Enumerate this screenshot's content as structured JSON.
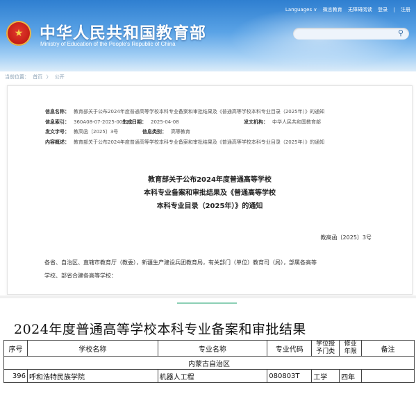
{
  "header": {
    "site_title": "中华人民共和国教育部",
    "site_subtitle": "Ministry of Education of the People's Republic of China",
    "topnav": [
      "Languages ∨",
      "微言教育",
      "无障碍阅读",
      "登录",
      "注册"
    ],
    "search_placeholder": ""
  },
  "breadcrumb": [
    "当前位置：",
    "首页",
    "〉",
    "公开"
  ],
  "meta": {
    "name_label": "信息名称：",
    "name_value": "教育部关于公布2024年度普通高等学校本科专业备案和审批结果及《普通高等学校本科专业目录（2025年）》的通知",
    "index_label": "信息索引：",
    "index_value": "360A08-07-2025-0002-1",
    "date_label": "生成日期：",
    "date_value": "2025-04-08",
    "issuer_label": "发文机构：",
    "issuer_value": "中华人民共和国教育部",
    "docno_label": "发文字号：",
    "docno_value": "教高函〔2025〕3号",
    "category_label": "信息类别：",
    "category_value": "高等教育",
    "summary_label": "内容概述：",
    "summary_value": "教育部关于公布2024年度普通高等学校本科专业备案和审批结果及《普通高等学校本科专业目录（2025年）》的通知"
  },
  "doc": {
    "title_lines": [
      "教育部关于公布2024年度普通高等学校",
      "本科专业备案和审批结果及《普通高等学校",
      "本科专业目录（2025年）》的通知"
    ],
    "doc_number": "教高函〔2025〕3号",
    "body_lines": [
      "各省、自治区、直辖市教育厅（教委），新疆生产建设兵团教育局，有关部门（单位）教育司（局），部属各高等",
      "学校、部省合建各高等学校："
    ]
  },
  "table": {
    "title": "2024年度普通高等学校本科专业备案和审批结果",
    "headers": [
      "序号",
      "学校名称",
      "专业名称",
      "专业代码",
      "学位授予门类",
      "修业年限",
      "备注"
    ],
    "region": "内蒙古自治区",
    "rows": [
      [
        "396",
        "呼和浩特民族学院",
        "机器人工程",
        "080803T",
        "工学",
        "四年",
        ""
      ]
    ]
  },
  "colors": {
    "header_blue": "#2f7fd0",
    "emblem_red": "#c61f17",
    "accent_green": "#8ccfb5"
  }
}
